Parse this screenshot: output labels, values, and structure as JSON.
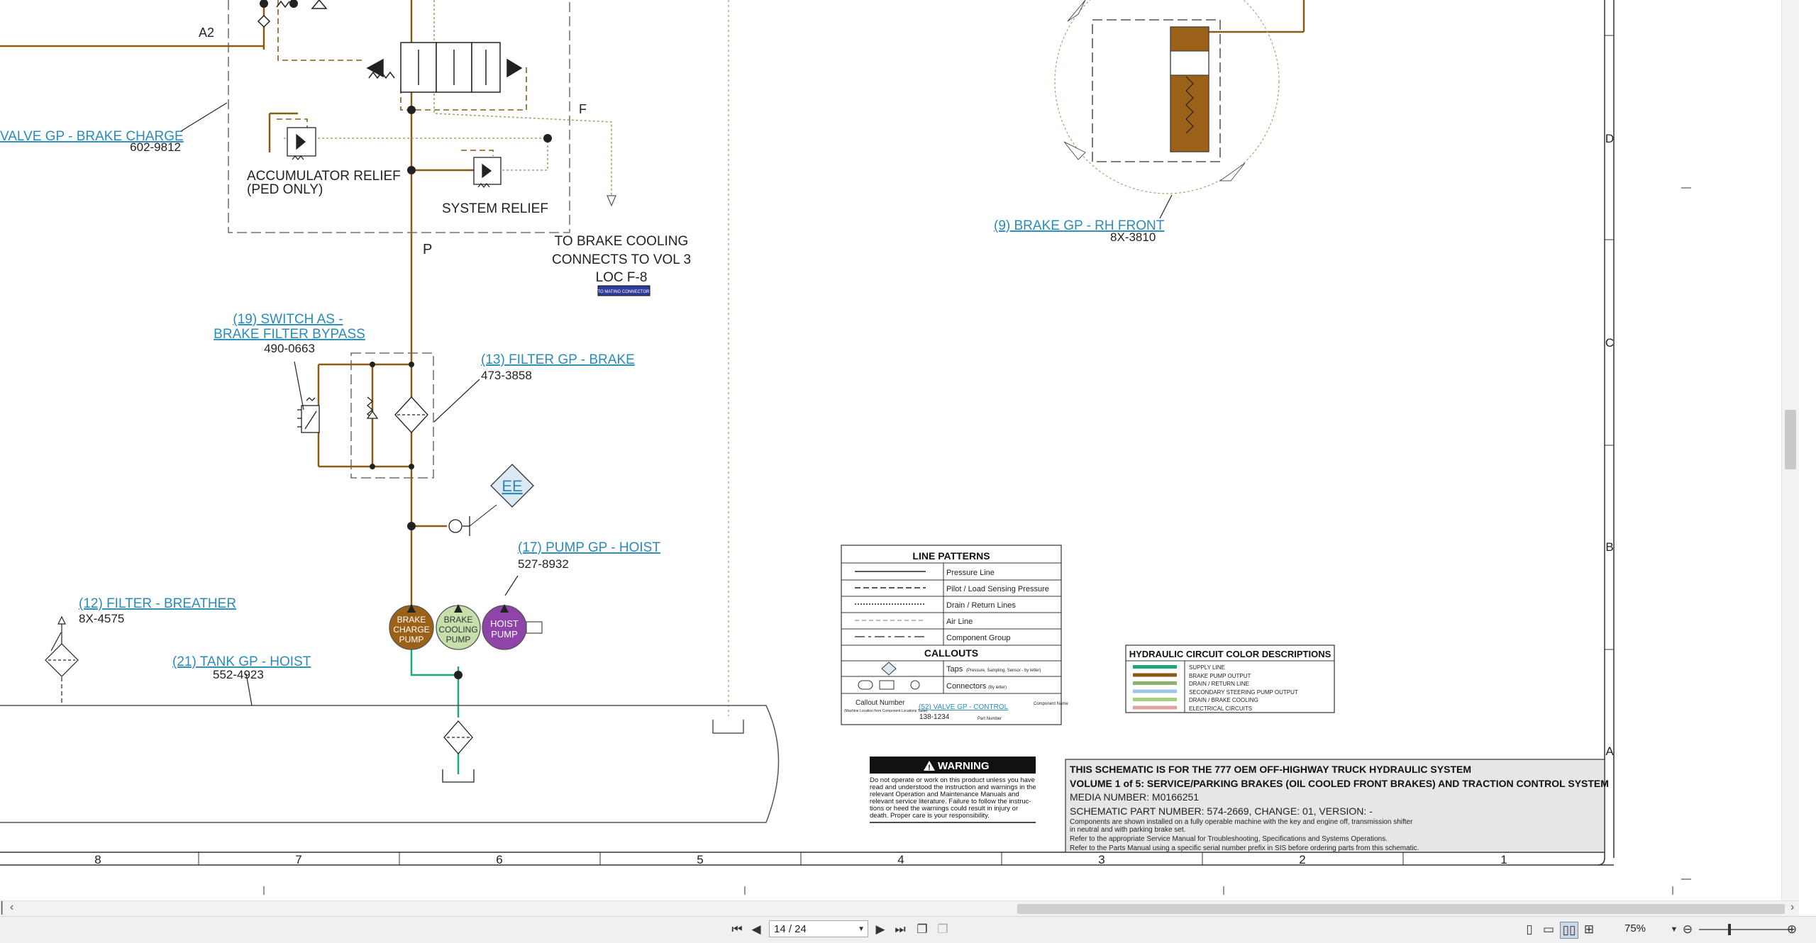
{
  "schematic": {
    "labels": {
      "a2": "A2",
      "f": "F",
      "p": "P",
      "accumulator_relief_1": "ACCUMULATOR RELIEF",
      "accumulator_relief_2": "(PED ONLY)",
      "system_relief": "SYSTEM RELIEF",
      "to_brake_cooling_1": "TO BRAKE COOLING",
      "to_brake_cooling_2": "CONNECTS TO VOL 3",
      "to_brake_cooling_3": "LOC F-8",
      "mating_connector": "TO MATING CONNECTOR"
    },
    "components": {
      "valve_brake_charge": {
        "name": "VALVE GP - BRAKE CHARGE",
        "part": "602-9812"
      },
      "switch_bypass": {
        "name1": "(19) SWITCH AS -",
        "name2": "BRAKE FILTER BYPASS",
        "part": "490-0663"
      },
      "filter_brake": {
        "name": "(13) FILTER GP - BRAKE",
        "part": "473-3858"
      },
      "tap_ee": {
        "name": "EE"
      },
      "pump_hoist": {
        "name": "(17) PUMP GP - HOIST",
        "part": "527-8932"
      },
      "filter_breather": {
        "name": "(12) FILTER - BREATHER",
        "part": "8X-4575"
      },
      "tank_hoist": {
        "name": "(21) TANK GP - HOIST",
        "part": "552-4923"
      },
      "brake_rh_front": {
        "name": "(9) BRAKE GP - RH FRONT",
        "part": "8X-3810"
      }
    },
    "pumps": {
      "brake_charge": [
        "BRAKE",
        "CHARGE",
        "PUMP"
      ],
      "brake_cooling": [
        "BRAKE",
        "COOLING",
        "PUMP"
      ],
      "hoist": [
        "HOIST",
        "PUMP"
      ]
    },
    "colors": {
      "brake_pump_output": "#8b5a14",
      "supply_line": "#1fa67a",
      "drain_return": "#8db36a",
      "pump_charge_fill": "#9c6118",
      "pump_cooling_fill": "#c7dfab",
      "pump_hoist_fill": "#8e44a8",
      "link_blue": "#2a8bb8"
    },
    "line_patterns": {
      "title": "LINE PATTERNS",
      "items": [
        "Pressure Line",
        "Pilot / Load Sensing Pressure",
        "Drain / Return Lines",
        "Air Line",
        "Component Group"
      ],
      "callouts_title": "CALLOUTS",
      "taps": "Taps",
      "taps_note": "(Pressure, Sampling, Sensor - by letter)",
      "connectors": "Connectors",
      "connectors_note": "(By letter)",
      "callout_number": "Callout Number",
      "callout_location": "(Machine Location from Component Locations Table)",
      "callout_example": "(52) VALVE GP - CONTROL",
      "callout_part": "138-1234",
      "component_name": "Component Name",
      "part_number": "Part Number"
    },
    "color_desc": {
      "title": "HYDRAULIC CIRCUIT COLOR DESCRIPTIONS",
      "items": [
        {
          "label": "SUPPLY LINE",
          "color": "#1fa67a"
        },
        {
          "label": "BRAKE PUMP OUTPUT",
          "color": "#8b5a14"
        },
        {
          "label": "DRAIN / RETURN LINE",
          "color": "#8db36a"
        },
        {
          "label": "SECONDARY STEERING PUMP OUTPUT",
          "color": "#9fc4e6"
        },
        {
          "label": "DRAIN / BRAKE COOLING",
          "color": "#a8cf7e"
        },
        {
          "label": "ELECTRICAL CIRCUITS",
          "color": "#e3a0a0"
        }
      ]
    },
    "warning": {
      "title": "WARNING",
      "lines": [
        "Do not operate or work on this product unless you have",
        "read and understood the instruction and warnings in the",
        "relevant Operation and Maintenance Manuals and",
        "relevant service literature. Failure to follow the instruc-",
        "tions or heed the warnings could result in injury or",
        "death. Proper care is your responsibility."
      ]
    },
    "title_block": {
      "line1": "THIS SCHEMATIC IS FOR THE 777 OEM OFF-HIGHWAY TRUCK HYDRAULIC SYSTEM",
      "line2": "VOLUME 1 of 5: SERVICE/PARKING BRAKES (OIL COOLED FRONT BRAKES) AND TRACTION CONTROL SYSTEM",
      "media": "MEDIA NUMBER: M0166251",
      "part": "SCHEMATIC PART NUMBER: 574-2669, CHANGE: 01, VERSION: -",
      "note1": "Components are shown installed on a fully operable machine with the key and engine off, transmission shifter",
      "note2": "in neutral and with parking brake set.",
      "note3": "Refer to the appropriate Service Manual for Troubleshooting, Specifications and Systems Operations.",
      "note4": "Refer to the Parts Manual using a specific serial number prefix in SIS before ordering parts from this schematic."
    },
    "grid": {
      "columns": [
        "8",
        "7",
        "6",
        "5",
        "4",
        "3",
        "2",
        "1"
      ],
      "rows": [
        "D",
        "C",
        "B",
        "A"
      ]
    }
  },
  "toolbar": {
    "page": "14 / 24",
    "zoom": "75%"
  }
}
